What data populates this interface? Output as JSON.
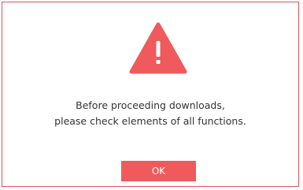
{
  "dialog": {
    "icon": "warning-triangle-icon",
    "message_line1": "Before proceeding downloads,",
    "message_line2": "please check elements of all functions.",
    "ok_label": "OK"
  },
  "colors": {
    "accent": "#f05a5d",
    "border": "#e0545a",
    "text": "#333333",
    "background": "#ffffff"
  }
}
